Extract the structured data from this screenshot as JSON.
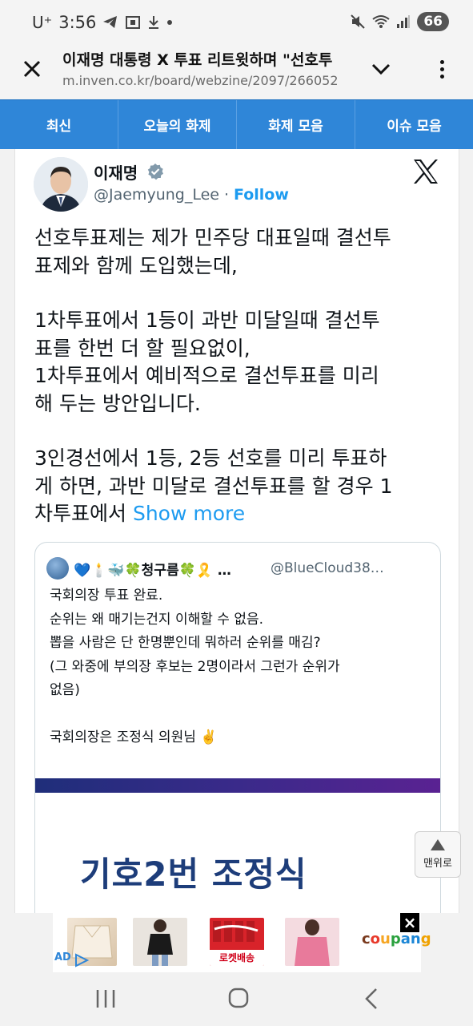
{
  "status_bar": {
    "carrier": "U⁺",
    "time": "3:56",
    "battery": "66",
    "icons": [
      "telegram-icon",
      "screenshot-icon",
      "download-icon",
      "dot-icon",
      "mute-icon",
      "wifi-icon",
      "signal-icon"
    ]
  },
  "browser": {
    "title": "이재명 대통령 X 투표 리트윗하며 \"선호투",
    "url": "m.inven.co.kr/board/webzine/2097/266052"
  },
  "nav": {
    "tabs": [
      {
        "label": "최신"
      },
      {
        "label": "오늘의 화제"
      },
      {
        "label": "화제 모음"
      },
      {
        "label": "이슈 모음"
      }
    ]
  },
  "tweet": {
    "author_name": "이재명",
    "author_handle": "@Jaemyung_Lee",
    "separator": "·",
    "follow_label": "Follow",
    "paragraphs": [
      "선호투표제는 제가 민주당 대표일때 결선투\n표제와 함께 도입했는데,",
      "1차투표에서 1등이 과반 미달일때 결선투\n표를 한번 더 할 필요없이,\n1차투표에서 예비적으로 결선투표를 미리\n해 두는 방안입니다."
    ],
    "last_paragraph": "3인경선에서 1등, 2등 선호를 미리 투표하\n게 하면, 과반 미달로 결선투표를 할 경우 1\n차투표에서 ",
    "show_more": "Show more"
  },
  "quote": {
    "name": "💙🕯️🐳🍀청구름🍀🎗️ …",
    "handle": "@BlueCloud38…",
    "lines": [
      "국회의장 투표 완료.",
      "순위는 왜 매기는건지 이해할 수 없음.",
      "뽑을 사람은 단 한명뿐인데 뭐하러 순위를 매김?",
      "(그 와중에 부의장 후보는 2명이라서 그런가 순위가",
      "없음)"
    ],
    "last_line": "국회의장은 조정식 의원님 ✌️",
    "image_text": "기호2번 조정식"
  },
  "to_top": {
    "label": "맨위로"
  },
  "ad": {
    "ad_label": "AD",
    "rocket_label": "로켓배송",
    "brand": [
      "c",
      "o",
      "u",
      "p",
      "a",
      "n",
      "g"
    ],
    "brand_colors": [
      "#7a3a1e",
      "#e8392b",
      "#f6a623",
      "#2aa13e",
      "#1b86d6",
      "#1b86d6",
      "#f0a200"
    ],
    "close": "×"
  },
  "colors": {
    "accent": "#2f86d8",
    "twitter_blue": "#1d9bf0",
    "verified_gray": "#829aab"
  }
}
